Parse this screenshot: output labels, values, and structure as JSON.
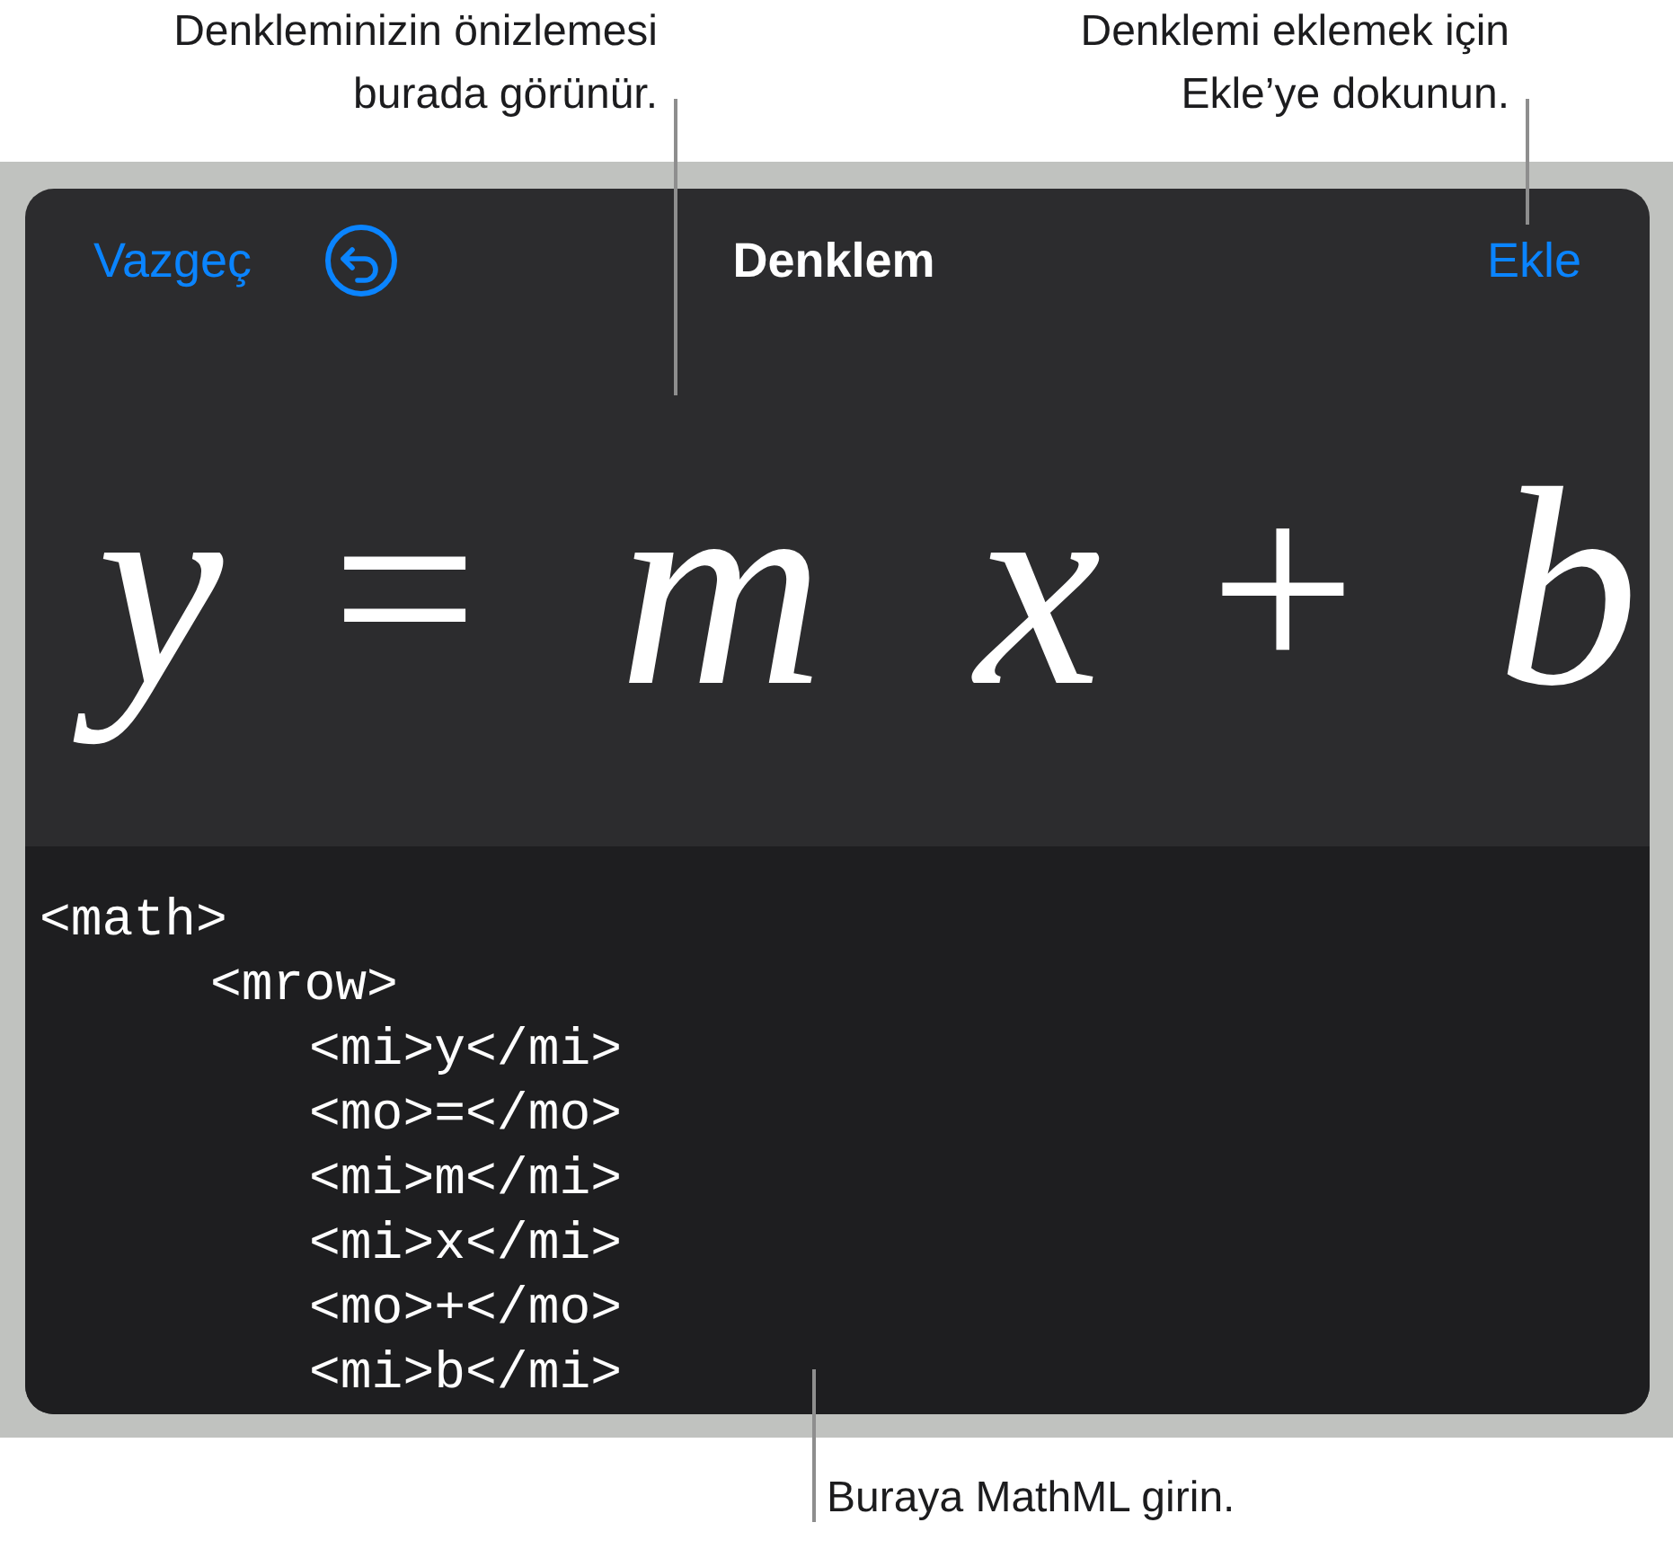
{
  "callouts_top": [
    {
      "lines": [
        "Denkleminizin önizlemesi",
        "burada görünür."
      ]
    },
    {
      "lines": [
        "Denklemi eklemek için",
        "Ekle’ye dokunun."
      ]
    }
  ],
  "header": {
    "cancel": "Vazgeç",
    "title": "Denklem",
    "insert": "Ekle"
  },
  "equation": [
    {
      "kind": "var",
      "text": "y"
    },
    {
      "kind": "op",
      "text": "="
    },
    {
      "kind": "var",
      "text": "m"
    },
    {
      "kind": "var",
      "text": "x"
    },
    {
      "kind": "op",
      "text": "+"
    },
    {
      "kind": "var",
      "text": "b"
    }
  ],
  "code": [
    {
      "text": "<math>",
      "children": [
        {
          "text": "<mrow>",
          "children": [
            {
              "text": "<mi>y</mi>"
            },
            {
              "text": "<mo>=</mo>"
            },
            {
              "text": "<mi>m</mi>"
            },
            {
              "text": "<mi>x</mi>"
            },
            {
              "text": "<mo>+</mo>"
            },
            {
              "text": "<mi>b</mi>"
            }
          ]
        }
      ]
    }
  ],
  "callout_bottom": "Buraya MathML girin."
}
